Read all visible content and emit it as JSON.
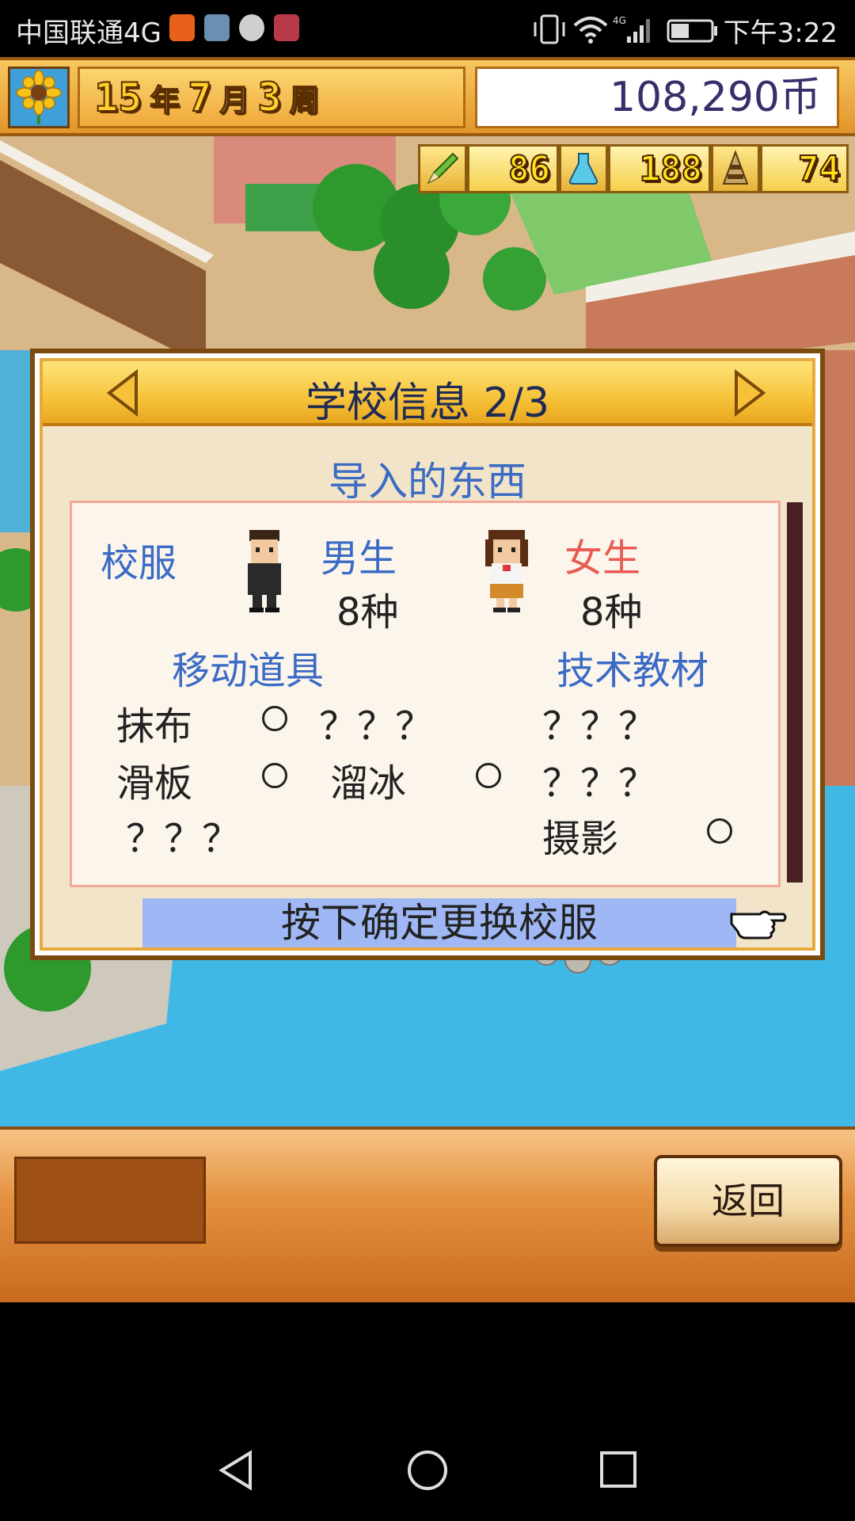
{
  "status_bar": {
    "carrier": "中国联通4G",
    "time": "下午3:22",
    "app_icons": [
      "taobao-icon",
      "bird-app-icon",
      "chat-icon",
      "huawei-icon"
    ],
    "right_icons": [
      "vibrate-icon",
      "wifi-icon",
      "signal-4g-icon",
      "battery-icon"
    ]
  },
  "hud": {
    "year_value": "15",
    "year_unit": "年",
    "month_value": "7",
    "month_unit": "月",
    "week_value": "3",
    "week_unit": "周",
    "coins": "108,290币",
    "stats": [
      {
        "icon": "pencil-icon",
        "value": "86"
      },
      {
        "icon": "flask-icon",
        "value": "188"
      },
      {
        "icon": "tower-icon",
        "value": "74"
      }
    ]
  },
  "dialog": {
    "title": "学校信息 2/3",
    "section_title": "导入的东西",
    "uniform_label": "校服",
    "boys_label": "男生",
    "boys_count": "8种",
    "girls_label": "女生",
    "girls_count": "8种",
    "mobile_items_title": "移动道具",
    "tech_materials_title": "技术教材",
    "mobile_items": [
      {
        "name": "抹布",
        "owned": "○"
      },
      {
        "name": "？？？",
        "owned": ""
      },
      {
        "name": "滑板",
        "owned": "○"
      },
      {
        "name": "溜冰",
        "owned": "○"
      },
      {
        "name": "？？？",
        "owned": ""
      }
    ],
    "tech_materials": [
      {
        "name": "？？？",
        "owned": ""
      },
      {
        "name": "？？？",
        "owned": ""
      },
      {
        "name": "摄影",
        "owned": "○"
      }
    ],
    "confirm_hint": "按下确定更换校服"
  },
  "bottom": {
    "back_label": "返回"
  },
  "colors": {
    "title_text": "#1f2a55",
    "blue_text": "#3b6bc4",
    "pink_text": "#e85a52",
    "hint_bar": "#9fb8f5",
    "header_gold": "#f7c23a"
  }
}
